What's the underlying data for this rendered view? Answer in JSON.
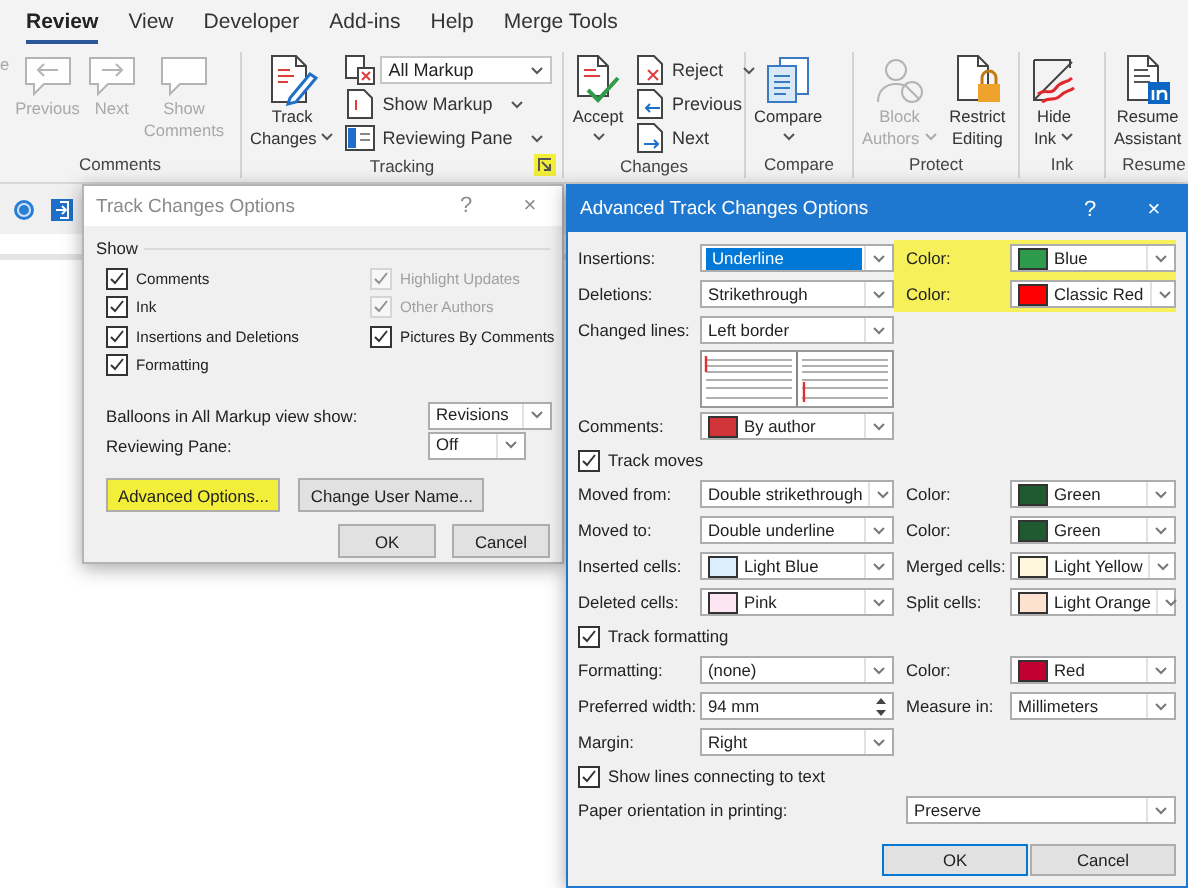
{
  "ribbon": {
    "tabs": [
      {
        "label": "Review",
        "selected": true
      },
      {
        "label": "View",
        "selected": false
      },
      {
        "label": "Developer",
        "selected": false
      },
      {
        "label": "Add-ins",
        "selected": false
      },
      {
        "label": "Help",
        "selected": false
      },
      {
        "label": "Merge Tools",
        "selected": false
      }
    ],
    "groups": [
      {
        "label": "Comments",
        "buttons": [
          {
            "kind": "large",
            "lines": [
              "e"
            ],
            "caret": false,
            "disabled": true
          },
          {
            "kind": "large",
            "lines": [
              "Previous"
            ],
            "caret": false,
            "disabled": true
          },
          {
            "kind": "large",
            "lines": [
              "Next"
            ],
            "caret": false,
            "disabled": true
          },
          {
            "kind": "large",
            "lines": [
              "Show",
              "Comments"
            ],
            "caret": false,
            "disabled": true
          }
        ]
      },
      {
        "label": "Tracking",
        "launcher": {
          "highlighted": true
        },
        "buttons": [
          {
            "kind": "large",
            "lines": [
              "Track",
              "Changes"
            ],
            "caret": true,
            "disabled": false
          },
          {
            "kind": "stack",
            "items": [
              {
                "kind": "combo",
                "value": "All Markup"
              },
              {
                "kind": "small",
                "label": "Show Markup",
                "caret": true,
                "disabled": false
              },
              {
                "kind": "small",
                "label": "Reviewing Pane",
                "caret": true,
                "disabled": false
              }
            ]
          }
        ]
      },
      {
        "label": "Changes",
        "buttons": [
          {
            "kind": "large",
            "lines": [
              "Accept"
            ],
            "caret": true,
            "disabled": false
          },
          {
            "kind": "stack",
            "items": [
              {
                "kind": "small",
                "label": "Reject",
                "caret": true,
                "disabled": false
              },
              {
                "kind": "small",
                "label": "Previous",
                "caret": false,
                "disabled": false
              },
              {
                "kind": "small",
                "label": "Next",
                "caret": false,
                "disabled": false
              }
            ]
          }
        ]
      },
      {
        "label": "Compare",
        "buttons": [
          {
            "kind": "large",
            "lines": [
              "Compare"
            ],
            "caret": true,
            "disabled": false
          }
        ]
      },
      {
        "label": "Protect",
        "buttons": [
          {
            "kind": "large",
            "lines": [
              "Block",
              "Authors"
            ],
            "caret": true,
            "disabled": true
          },
          {
            "kind": "large",
            "lines": [
              "Restrict",
              "Editing"
            ],
            "caret": false,
            "disabled": false
          }
        ]
      },
      {
        "label": "Ink",
        "buttons": [
          {
            "kind": "large",
            "lines": [
              "Hide",
              "Ink"
            ],
            "caret": true,
            "disabled": false
          }
        ]
      },
      {
        "label": "Resume",
        "buttons": [
          {
            "kind": "large",
            "lines": [
              "Resume",
              "Assistant"
            ],
            "caret": false,
            "disabled": false
          }
        ]
      }
    ]
  },
  "track_changes_dialog": {
    "title": "Track Changes Options",
    "active": false,
    "title_buttons": [
      "?",
      "×"
    ],
    "section": "Show",
    "show_columns": [
      [
        {
          "label": "Comments",
          "checked": true,
          "disabled": false
        },
        {
          "label": "Ink",
          "checked": true,
          "disabled": false
        },
        {
          "label": "Insertions and Deletions",
          "checked": true,
          "disabled": false
        },
        {
          "label": "Formatting",
          "checked": true,
          "disabled": false
        }
      ],
      [
        {
          "label": "Highlight Updates",
          "checked": true,
          "disabled": true
        },
        {
          "label": "Other Authors",
          "checked": true,
          "disabled": true
        },
        {
          "label": "Pictures By Comments",
          "checked": true,
          "disabled": false
        }
      ]
    ],
    "fields": [
      {
        "label": "Balloons in All Markup view show:",
        "value": "Revisions"
      },
      {
        "label": "Reviewing Pane:",
        "value": "Off"
      }
    ],
    "buttons": [
      {
        "label": "Advanced Options...",
        "highlighted": true
      },
      {
        "label": "Change User Name...",
        "highlighted": false
      }
    ],
    "footer_buttons": [
      {
        "label": "OK",
        "default": false
      },
      {
        "label": "Cancel",
        "default": false
      }
    ]
  },
  "advanced_dialog": {
    "title": "Advanced Track Changes Options",
    "active": true,
    "title_buttons": [
      "?",
      "×"
    ],
    "rows": [
      {
        "kind": "pair",
        "label": "Insertions:",
        "field": {
          "value": "Underline",
          "focused": true
        },
        "right": {
          "label": "Color:",
          "highlighted": true,
          "field": {
            "value": "Blue",
            "color": "#2e9a4c",
            "focused": false
          }
        }
      },
      {
        "kind": "pair",
        "label": "Deletions:",
        "field": {
          "value": "Strikethrough",
          "focused": false
        },
        "right": {
          "label": "Color:",
          "highlighted": true,
          "field": {
            "value": "Classic Red",
            "color": "#ff0000",
            "focused": false
          }
        }
      },
      {
        "kind": "pair",
        "label": "Changed lines:",
        "field": {
          "value": "Left border",
          "focused": false
        }
      },
      {
        "kind": "preview"
      },
      {
        "kind": "pair",
        "label": "Comments:",
        "field": {
          "value": "By author",
          "color": "#d13438",
          "focused": false
        }
      },
      {
        "kind": "checkbox",
        "label": "Track moves",
        "checked": true
      },
      {
        "kind": "pair",
        "label": "Moved from:",
        "field": {
          "value": "Double strikethrough",
          "focused": false
        },
        "right": {
          "label": "Color:",
          "highlighted": false,
          "field": {
            "value": "Green",
            "color": "#1f5a30",
            "focused": false
          }
        }
      },
      {
        "kind": "pair",
        "label": "Moved to:",
        "field": {
          "value": "Double underline",
          "focused": false
        },
        "right": {
          "label": "Color:",
          "highlighted": false,
          "field": {
            "value": "Green",
            "color": "#1f5a30",
            "focused": false
          }
        }
      },
      {
        "kind": "pair",
        "label": "Inserted cells:",
        "field": {
          "value": "Light Blue",
          "color": "#dcedfb",
          "focused": false
        },
        "right": {
          "label": "Merged cells:",
          "highlighted": false,
          "field": {
            "value": "Light Yellow",
            "color": "#fff6de",
            "focused": false
          }
        }
      },
      {
        "kind": "pair",
        "label": "Deleted cells:",
        "field": {
          "value": "Pink",
          "color": "#fce6f1",
          "focused": false
        },
        "right": {
          "label": "Split cells:",
          "highlighted": false,
          "field": {
            "value": "Light Orange",
            "color": "#fde3cf",
            "focused": false
          }
        }
      },
      {
        "kind": "checkbox",
        "label": "Track formatting",
        "checked": true
      },
      {
        "kind": "pair",
        "label": "Formatting:",
        "field": {
          "value": "(none)",
          "focused": false
        },
        "right": {
          "label": "Color:",
          "highlighted": false,
          "field": {
            "value": "Red",
            "color": "#c00030",
            "focused": false
          }
        }
      },
      {
        "kind": "pair",
        "label": "Preferred width:",
        "field": {
          "spinner": true,
          "value": "94 mm",
          "focused": false
        },
        "right": {
          "label": "Measure in:",
          "highlighted": false,
          "field": {
            "value": "Millimeters",
            "focused": false
          }
        }
      },
      {
        "kind": "pair",
        "label": "Margin:",
        "field": {
          "value": "Right",
          "focused": false
        }
      },
      {
        "kind": "checkbox",
        "label": "Show lines connecting to text",
        "checked": true
      },
      {
        "kind": "wide",
        "label": "Paper orientation in printing:",
        "field": {
          "value": "Preserve",
          "focused": false
        }
      }
    ],
    "buttons": [
      {
        "label": "OK",
        "default": true
      },
      {
        "label": "Cancel",
        "default": false
      }
    ]
  }
}
